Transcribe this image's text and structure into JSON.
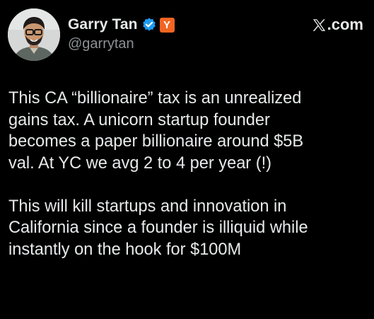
{
  "author": {
    "display_name": "Garry Tan",
    "handle": "@garrytan",
    "affiliate_badge": "Y",
    "verified_icon": "verified-checkmark-icon",
    "badge_color": "#f26522",
    "verified_color": "#1d9bf0"
  },
  "source": {
    "text": ".com",
    "icon": "x-logo-icon"
  },
  "tweet": {
    "paragraphs": [
      "This CA “billionaire” tax is an unrealized\ngains tax. A unicorn startup founder\nbecomes a paper billionaire around $5B\nval. At YC we avg 2 to 4 per year (!)",
      "This will kill startups and innovation in\nCalifornia since a founder is illiquid while\ninstantly on the hook for $100M"
    ]
  },
  "colors": {
    "background": "#000000",
    "text": "#e7e9ea",
    "secondary_text": "#8b9196"
  }
}
